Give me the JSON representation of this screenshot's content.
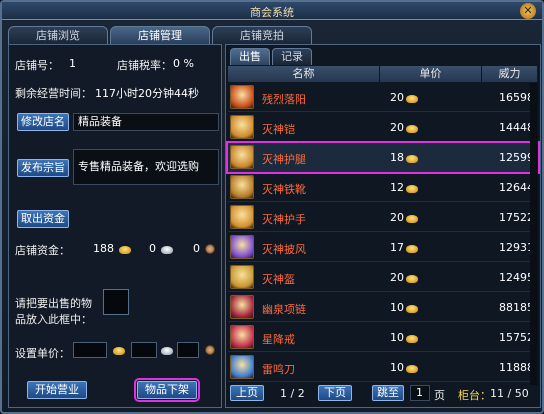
{
  "window": {
    "title": "商会系统",
    "close_icon": "close-icon"
  },
  "tabs": [
    {
      "label": "店铺浏览",
      "active": false
    },
    {
      "label": "店铺管理",
      "active": true
    },
    {
      "label": "店铺竞拍",
      "active": false
    }
  ],
  "shop": {
    "id_label": "店铺号：",
    "id_value": "1",
    "tax_label": "店铺税率：",
    "tax_value": "0 %",
    "time_label": "剩余经营时间：",
    "time_value": "117小时20分钟44秒",
    "rename_button": "修改店名",
    "name_value": "精品装备",
    "motto_button": "发布宗旨",
    "motto_value": "专售精品装备，欢迎选购",
    "withdraw_button": "取出资金",
    "funds_label": "店铺资金：",
    "funds_gold": "188",
    "funds_silver": "0",
    "funds_copper": "0",
    "put_item_text_line1": "请把要出售的物",
    "put_item_text_line2": "品放入此框中：",
    "set_price_label": "设置单价：",
    "open_button": "开始营业",
    "unlist_button": "物品下架"
  },
  "list": {
    "tabs": [
      {
        "label": "出售",
        "active": true
      },
      {
        "label": "记录",
        "active": false
      }
    ],
    "columns": {
      "name": "名称",
      "price": "单价",
      "power": "威力"
    },
    "items": [
      {
        "name": "残烈落阳",
        "price": "20",
        "power": "16598",
        "icon_color": "#c84a1a"
      },
      {
        "name": "灭神铠",
        "price": "20",
        "power": "14448",
        "icon_color": "#d08a2a"
      },
      {
        "name": "灭神护腿",
        "price": "18",
        "power": "12599",
        "icon_color": "#c9862a",
        "selected": true
      },
      {
        "name": "灭神铁靴",
        "price": "12",
        "power": "12644",
        "icon_color": "#b87a24"
      },
      {
        "name": "灭神护手",
        "price": "20",
        "power": "17522",
        "icon_color": "#d4902e"
      },
      {
        "name": "灭神披风",
        "price": "17",
        "power": "12931",
        "icon_color": "#7a4ad0"
      },
      {
        "name": "灭神盔",
        "price": "20",
        "power": "12495",
        "icon_color": "#c8962e"
      },
      {
        "name": "幽泉项链",
        "price": "10",
        "power": "88185",
        "icon_color": "#a0203a"
      },
      {
        "name": "星降戒",
        "price": "10",
        "power": "15752",
        "icon_color": "#c02a4a"
      },
      {
        "name": "雷鸣刀",
        "price": "10",
        "power": "11888",
        "icon_color": "#3a7ad0"
      }
    ],
    "pager": {
      "prev": "上页",
      "page": "1 / 2",
      "next": "下页",
      "jump": "跳至",
      "jump_value": "1",
      "page_unit": "页",
      "counter_label": "柜台：",
      "counter_value": "11 / 50"
    }
  }
}
